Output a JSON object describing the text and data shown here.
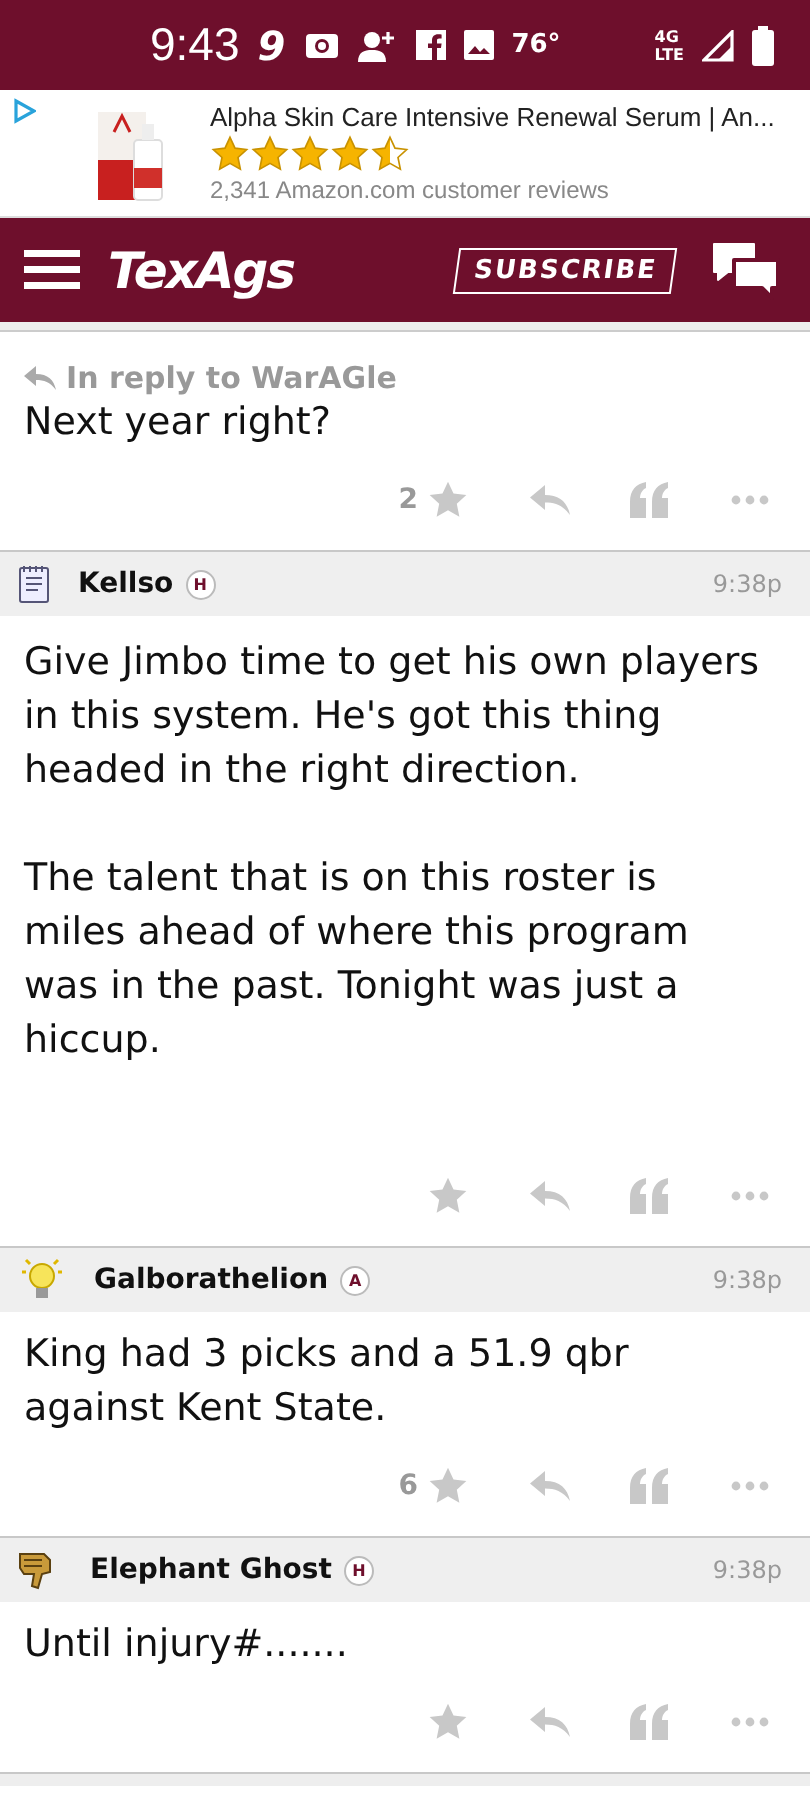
{
  "status_bar": {
    "time": "9:43",
    "app_badge": "9",
    "temperature": "76°",
    "network_top": "4G",
    "network_bottom": "LTE"
  },
  "ad": {
    "title": "Alpha Skin Care Intensive Renewal Serum | An...",
    "stars": 4.5,
    "reviews": "2,341 Amazon.com customer reviews"
  },
  "nav": {
    "logo": "TexAgs",
    "subscribe": "SUBSCRIBE"
  },
  "posts": [
    {
      "kind": "reply",
      "reply_to": "In reply to WarAGle",
      "paragraphs": [
        "Next year right?"
      ],
      "star_count": "2"
    },
    {
      "kind": "post",
      "avatar": {
        "kind": "notepad"
      },
      "author": "Kellso",
      "badge": "H",
      "time": "9:38p",
      "paragraphs": [
        "Give Jimbo time to get his own players in this system. He's got this thing headed in the right direction.",
        "The talent that is on this roster is miles ahead of where this program was in the past. Tonight was just a hiccup."
      ],
      "tall": true
    },
    {
      "kind": "post",
      "avatar": {
        "kind": "bulb"
      },
      "author": "Galborathelion",
      "badge": "A",
      "time": "9:38p",
      "paragraphs": [
        "King had 3 picks and a 51.9 qbr against Kent State."
      ],
      "star_count": "6"
    },
    {
      "kind": "post",
      "avatar": {
        "kind": "hand"
      },
      "author": "Elephant Ghost",
      "badge": "H",
      "time": "9:38p",
      "paragraphs": [
        "Until injury#......."
      ]
    }
  ]
}
